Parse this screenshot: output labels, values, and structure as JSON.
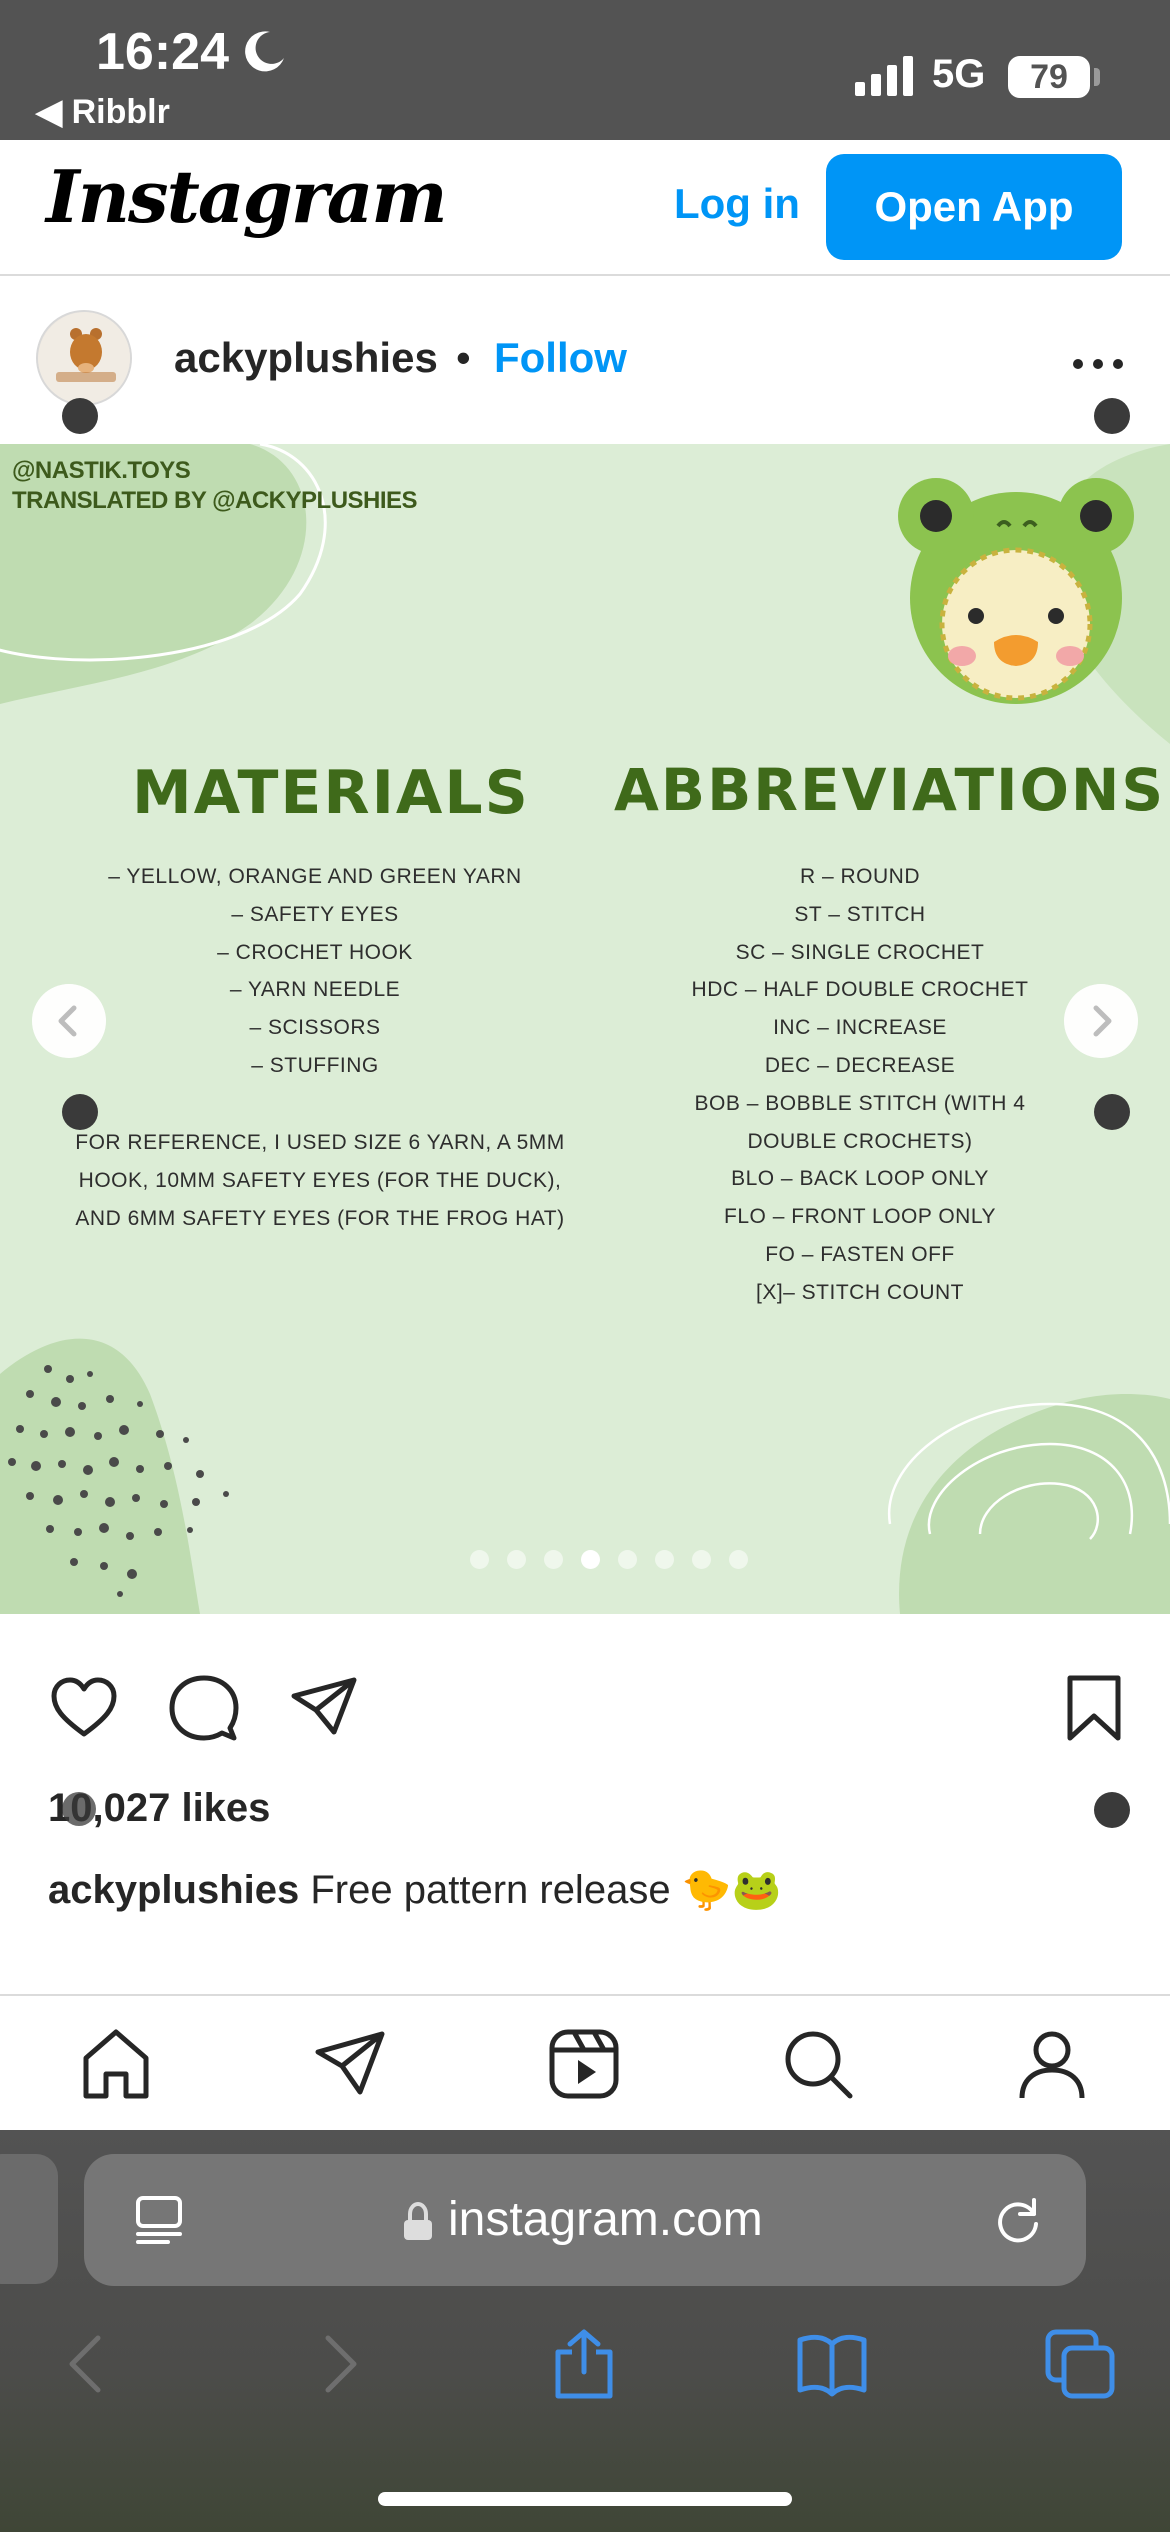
{
  "status_bar": {
    "time": "16:24",
    "back_app": "◀ Ribblr",
    "network": "5G",
    "battery": "79"
  },
  "ig_header": {
    "logo": "Instagram",
    "login_label": "Log in",
    "open_app_label": "Open App"
  },
  "post": {
    "username": "ackyplushies",
    "separator": "•",
    "follow_label": "Follow",
    "image": {
      "credit_line1": "@NASTIK.TOYS",
      "credit_line2": "TRANSLATED BY @ACKYPLUSHIES",
      "materials_title": "MATERIALS",
      "materials": [
        "– YELLOW, ORANGE AND GREEN YARN",
        "– SAFETY EYES",
        "– CROCHET HOOK",
        "– YARN NEEDLE",
        "– SCISSORS",
        "– STUFFING"
      ],
      "reference_note": "FOR REFERENCE, I USED SIZE 6 YARN, A 5MM HOOK, 10MM SAFETY EYES (FOR THE DUCK), AND 6MM SAFETY EYES (FOR THE FROG HAT)",
      "abbreviations_title": "ABBREVIATIONS",
      "abbreviations": [
        "R – ROUND",
        "ST – STITCH",
        "SC – SINGLE CROCHET",
        "HDC – HALF DOUBLE CROCHET",
        "INC – INCREASE",
        "DEC – DECREASE",
        "BOB – BOBBLE STITCH (WITH 4",
        "DOUBLE CROCHETS)",
        "BLO – BACK LOOP ONLY",
        "FLO – FRONT LOOP ONLY",
        "FO – FASTEN OFF",
        "[X]– STITCH COUNT"
      ]
    },
    "carousel": {
      "count": 8,
      "active_index": 3
    },
    "likes": "10,027 likes",
    "caption_user": "ackyplushies",
    "caption_text": " Free pattern release 🐤🐸"
  },
  "safari": {
    "url": "instagram.com"
  },
  "colors": {
    "ig_blue": "#0095f6",
    "post_bg": "#dcedd6",
    "title_green": "#3f6a1a",
    "safari_bg": "#535353"
  },
  "icons": {
    "actions": [
      "heart-icon",
      "comment-icon",
      "share-icon",
      "bookmark-icon"
    ],
    "nav": [
      "home-icon",
      "direct-icon",
      "reels-icon",
      "search-icon",
      "profile-icon"
    ],
    "safari": [
      "back-icon",
      "forward-icon",
      "share-icon",
      "bookmarks-icon",
      "tabs-icon"
    ]
  }
}
